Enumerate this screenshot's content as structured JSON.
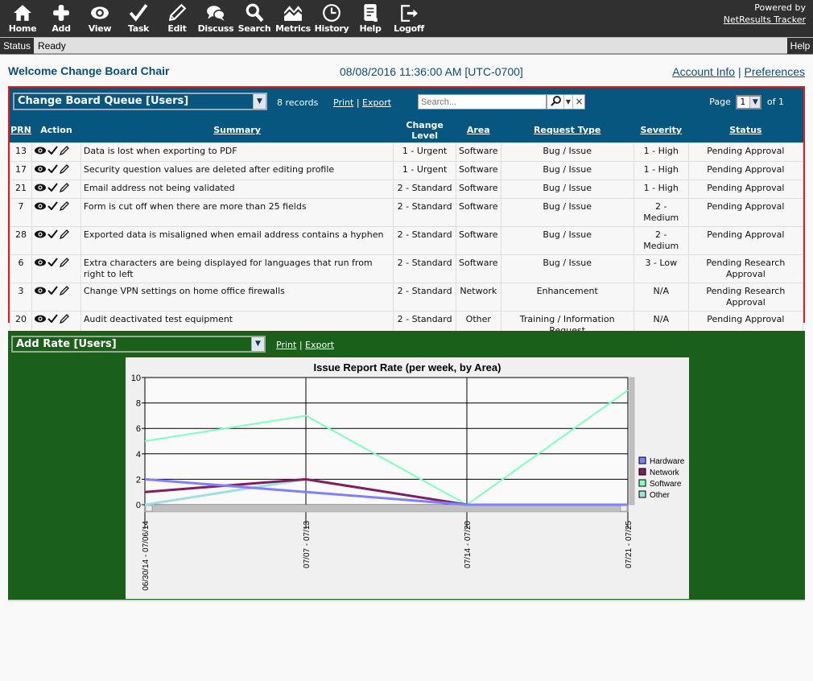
{
  "toolbar": {
    "items": [
      {
        "label": "Home",
        "icon": "home-icon"
      },
      {
        "label": "Add",
        "icon": "plus-icon"
      },
      {
        "label": "View",
        "icon": "eye-icon"
      },
      {
        "label": "Task",
        "icon": "check-icon"
      },
      {
        "label": "Edit",
        "icon": "pencil-icon"
      },
      {
        "label": "Discuss",
        "icon": "chat-bubbles-icon"
      },
      {
        "label": "Search",
        "icon": "magnifier-icon"
      },
      {
        "label": "Metrics",
        "icon": "metrics-chart-icon"
      },
      {
        "label": "History",
        "icon": "clock-icon"
      },
      {
        "label": "Help",
        "icon": "document-icon"
      },
      {
        "label": "Logoff",
        "icon": "logoff-arrow-icon"
      }
    ],
    "powered_by": "Powered by",
    "product_link": "NetResults Tracker"
  },
  "statusbar": {
    "label": "Status",
    "value": "Ready",
    "help": "Help"
  },
  "header": {
    "welcome": "Welcome Change Board Chair",
    "datetime": "08/08/2016 11:36:00 AM [UTC-0700]",
    "account_info": "Account Info",
    "separator": "|",
    "preferences": "Preferences"
  },
  "queue": {
    "report_name": "Change Board Queue [Users]",
    "records": "8 records",
    "print": "Print",
    "export": "Export",
    "search_placeholder": "Search...",
    "page_label": "Page",
    "page_value": "1",
    "page_of": "of 1",
    "columns": [
      "PRN",
      "Action",
      "Summary",
      "Change Level",
      "Area",
      "Request Type",
      "Severity",
      "Status"
    ],
    "rows": [
      {
        "prn": "13",
        "summary": "Data is lost when exporting to PDF",
        "change_level": "1 - Urgent",
        "area": "Software",
        "request_type": "Bug / Issue",
        "severity": "1 - High",
        "status": "Pending Approval"
      },
      {
        "prn": "17",
        "summary": "Security question values are deleted after editing profile",
        "change_level": "1 - Urgent",
        "area": "Software",
        "request_type": "Bug / Issue",
        "severity": "1 - High",
        "status": "Pending Approval"
      },
      {
        "prn": "21",
        "summary": "Email address not being validated",
        "change_level": "2 - Standard",
        "area": "Software",
        "request_type": "Bug / Issue",
        "severity": "1 - High",
        "status": "Pending Approval"
      },
      {
        "prn": "7",
        "summary": "Form is cut off when there are more than 25 fields",
        "change_level": "2 - Standard",
        "area": "Software",
        "request_type": "Bug / Issue",
        "severity": "2 - Medium",
        "status": "Pending Approval"
      },
      {
        "prn": "28",
        "summary": "Exported data is misaligned when email address contains a hyphen",
        "change_level": "2 - Standard",
        "area": "Software",
        "request_type": "Bug / Issue",
        "severity": "2 - Medium",
        "status": "Pending Approval"
      },
      {
        "prn": "6",
        "summary": "Extra characters are being displayed for languages that run from right to left",
        "change_level": "2 - Standard",
        "area": "Software",
        "request_type": "Bug / Issue",
        "severity": "3 - Low",
        "status": "Pending Research Approval"
      },
      {
        "prn": "3",
        "summary": "Change VPN settings on home office firewalls",
        "change_level": "2 - Standard",
        "area": "Network",
        "request_type": "Enhancement",
        "severity": "N/A",
        "status": "Pending Research Approval"
      },
      {
        "prn": "20",
        "summary": "Audit deactivated test equipment",
        "change_level": "2 - Standard",
        "area": "Other",
        "request_type": "Training / Information Request",
        "severity": "N/A",
        "status": "Pending Approval"
      }
    ]
  },
  "metrics": {
    "report_name": "Add Rate [Users]",
    "print": "Print",
    "export": "Export"
  },
  "chart_data": {
    "type": "line",
    "title": "Issue Report Rate (per week, by Area)",
    "xlabel": "",
    "ylabel": "",
    "x": [
      "06/30/14 - 07/06/14",
      "07/07 - 07/13",
      "07/14 - 07/20",
      "07/21 - 07/25"
    ],
    "yticks": [
      0,
      2,
      4,
      6,
      8,
      10
    ],
    "ylim": [
      0,
      10
    ],
    "grid": true,
    "legend": "right",
    "series": [
      {
        "name": "Hardware",
        "color": "#8080ff",
        "values": [
          2,
          1,
          0,
          0
        ]
      },
      {
        "name": "Network",
        "color": "#7f1f5f",
        "values": [
          1,
          2,
          0,
          0
        ]
      },
      {
        "name": "Software",
        "color": "#80ffc0",
        "values": [
          5,
          7,
          0,
          9
        ]
      },
      {
        "name": "Other",
        "color": "#a0e0e0",
        "values": [
          0,
          2,
          0,
          0
        ]
      }
    ]
  },
  "colors": {
    "queue_header": "#07567f",
    "queue_border": "#e31b1b",
    "chart_panel": "#1a5f1a",
    "toolbar": "#303030"
  }
}
